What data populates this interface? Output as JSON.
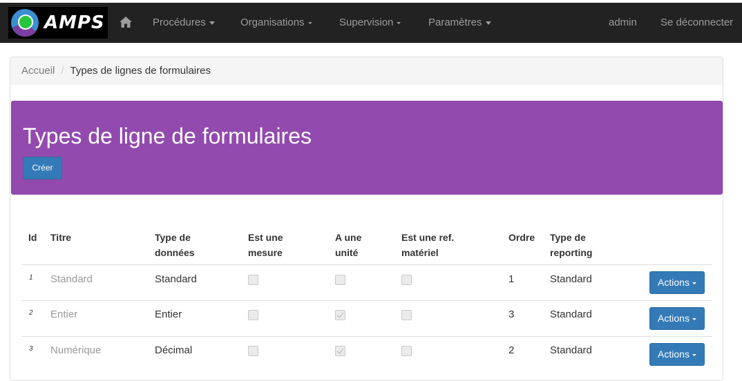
{
  "navbar": {
    "brand": "AMPS",
    "menus": [
      {
        "label": "Procédures"
      },
      {
        "label": "Organisations"
      },
      {
        "label": "Supervision"
      },
      {
        "label": "Paramètres"
      }
    ],
    "user": "admin",
    "logout": "Se déconnecter"
  },
  "breadcrumb": {
    "home": "Accueil",
    "separator": "/",
    "current": "Types de lignes de formulaires"
  },
  "header": {
    "title": "Types de ligne de formulaires",
    "create_label": "Créer",
    "bg_color": "#934aae"
  },
  "table": {
    "headers": {
      "id": "Id",
      "titre": "Titre",
      "type_donnees_1": "Type de",
      "type_donnees_2": "données",
      "mesure_1": "Est une",
      "mesure_2": "mesure",
      "unite_1": "A une",
      "unite_2": "unité",
      "ref_1": "Est une ref.",
      "ref_2": "matériel",
      "ordre": "Ordre",
      "reporting_1": "Type de",
      "reporting_2": "reporting"
    },
    "rows": [
      {
        "id": "1",
        "titre": "Standard",
        "type": "Standard",
        "mesure": false,
        "unite": false,
        "ref": false,
        "ordre": "1",
        "reporting": "Standard",
        "actions": "Actions"
      },
      {
        "id": "2",
        "titre": "Entier",
        "type": "Entier",
        "mesure": false,
        "unite": true,
        "ref": false,
        "ordre": "3",
        "reporting": "Standard",
        "actions": "Actions"
      },
      {
        "id": "3",
        "titre": "Numérique",
        "type": "Décimal",
        "mesure": false,
        "unite": true,
        "ref": false,
        "ordre": "2",
        "reporting": "Standard",
        "actions": "Actions"
      }
    ]
  }
}
